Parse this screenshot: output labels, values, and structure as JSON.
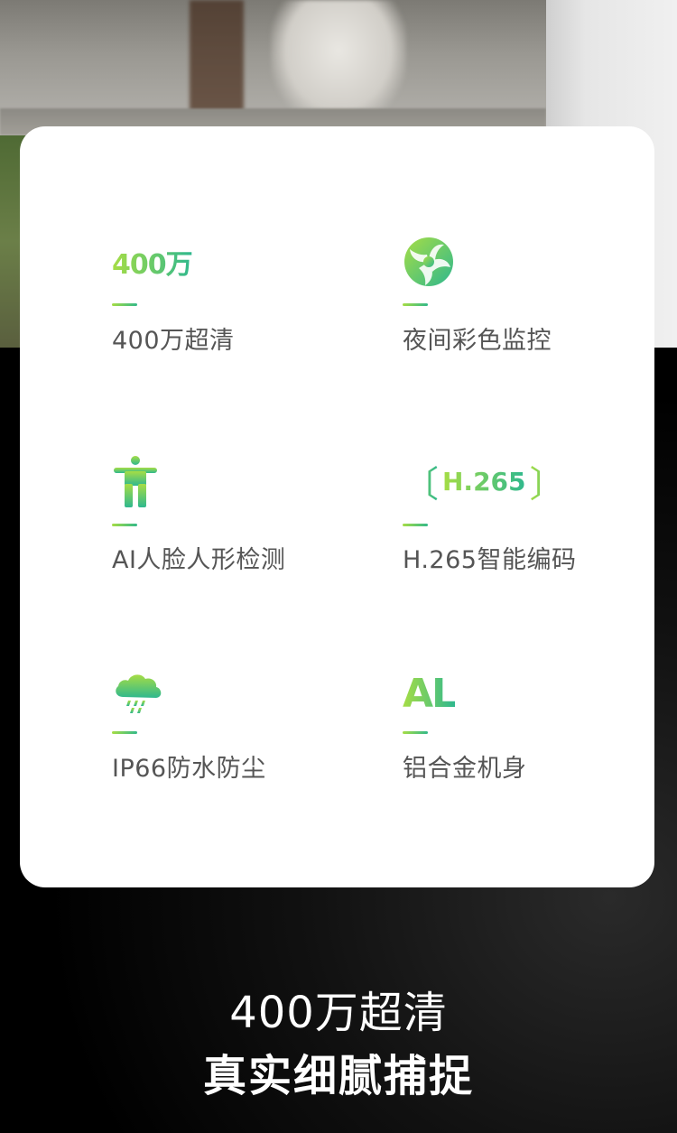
{
  "features": [
    {
      "icon_text": "400万",
      "label": "400万超清",
      "icon": "400w-badge-icon"
    },
    {
      "label": "夜间彩色监控",
      "icon": "swirl-aperture-icon"
    },
    {
      "label": "AI人脸人形检测",
      "icon": "person-figure-icon"
    },
    {
      "icon_text": "H.265",
      "label": "H.265智能编码",
      "icon": "h265-codec-icon"
    },
    {
      "label": "IP66防水防尘",
      "icon": "rain-cloud-icon"
    },
    {
      "icon_text": "AL",
      "label": "铝合金机身",
      "icon": "al-material-icon"
    }
  ],
  "headline": {
    "line1": "400万超清",
    "line2": "真实细腻捕捉"
  },
  "colors": {
    "accent_start": "#a6dd45",
    "accent_end": "#2fb88e",
    "label_text": "#555555",
    "card_bg": "#ffffff",
    "page_bg": "#000000"
  }
}
